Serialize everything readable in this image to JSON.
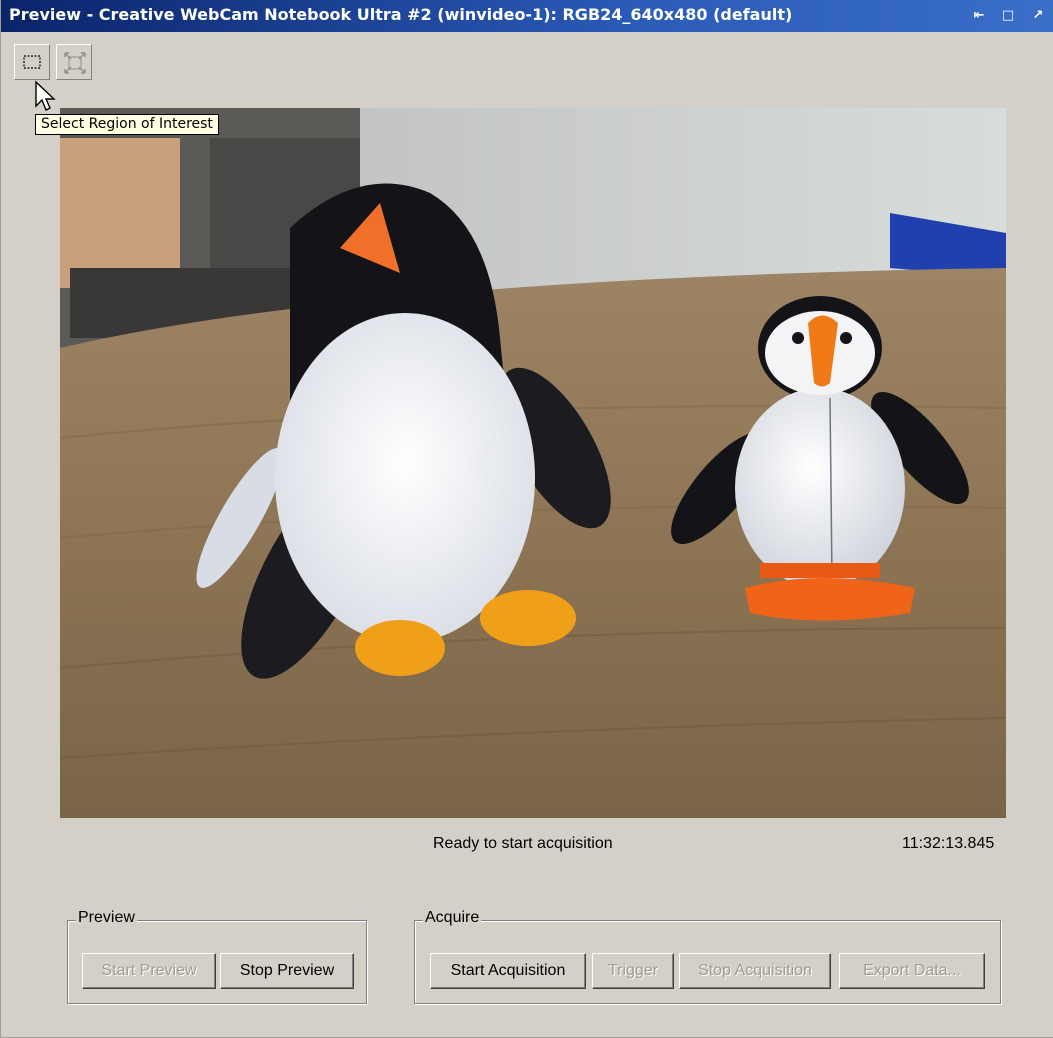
{
  "window": {
    "title": "Preview - Creative WebCam Notebook Ultra #2 (winvideo-1): RGB24_640x480 (default)",
    "controls": [
      "⇤",
      "□",
      "↗"
    ]
  },
  "toolbar": {
    "tooltip": "Select Region of Interest",
    "buttons": [
      "select-region-icon",
      "fit-icon"
    ]
  },
  "status": {
    "message": "Ready to start acquisition",
    "timestamp": "11:32:13.845"
  },
  "preview_group": {
    "label": "Preview",
    "start_label": "Start Preview",
    "stop_label": "Stop Preview"
  },
  "acquire_group": {
    "label": "Acquire",
    "start_label": "Start Acquisition",
    "trigger_label": "Trigger",
    "stop_label": "Stop Acquisition",
    "export_label": "Export Data..."
  },
  "colors": {
    "titlebar": "#0a246a",
    "face": "#d4d0c8",
    "tooltip": "#ffffe1"
  }
}
